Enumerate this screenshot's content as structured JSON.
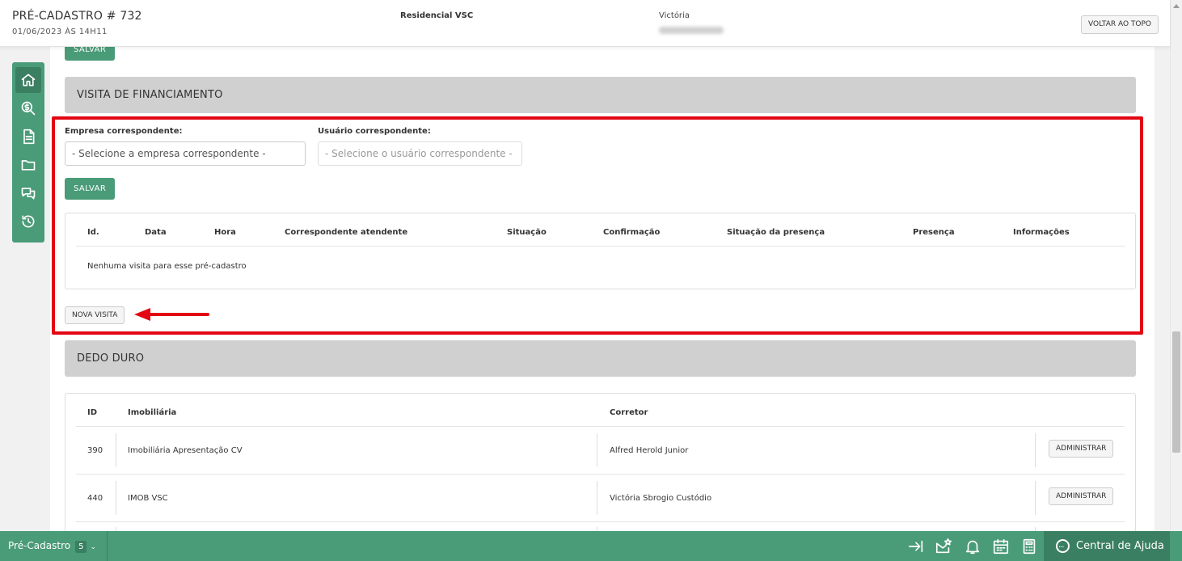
{
  "header": {
    "title": "PRÉ-CADASTRO # 732",
    "datetime": "01/06/2023 ÀS 14H11",
    "empreendimento": "Residencial VSC",
    "cliente": "Victória",
    "voltar_topo": "VOLTAR AO TOPO"
  },
  "sidebar": {
    "items": [
      {
        "icon": "home-icon"
      },
      {
        "icon": "dollar-search-icon"
      },
      {
        "icon": "document-icon"
      },
      {
        "icon": "folder-icon"
      },
      {
        "icon": "chat-icon"
      },
      {
        "icon": "history-icon"
      }
    ]
  },
  "top_save": "SALVAR",
  "visita": {
    "section_title": "VISITA DE FINANCIAMENTO",
    "empresa_label": "Empresa correspondente:",
    "empresa_placeholder": "- Selecione a empresa correspondente -",
    "usuario_label": "Usuário correspondente:",
    "usuario_placeholder": "- Selecione o usuário correspondente -",
    "save": "SALVAR",
    "columns": [
      "Id.",
      "Data",
      "Hora",
      "Correspondente atendente",
      "Situação",
      "Confirmação",
      "Situação da presença",
      "Presença",
      "Informações"
    ],
    "empty": "Nenhuma visita para esse pré-cadastro",
    "nova_visita": "NOVA VISITA"
  },
  "dedo_duro": {
    "section_title": "DEDO DURO",
    "columns": [
      "ID",
      "Imobiliária",
      "Corretor"
    ],
    "rows": [
      {
        "id": "390",
        "imobiliaria": "Imobiliária Apresentação CV",
        "corretor": "Alfred Herold Junior",
        "action": "ADMINISTRAR"
      },
      {
        "id": "440",
        "imobiliaria": "IMOB VSC",
        "corretor": "Victória Sbrogio Custódio",
        "action": "ADMINISTRAR"
      }
    ]
  },
  "bottombar": {
    "tab_label": "Pré-Cadastro",
    "tab_count": "5",
    "icons": [
      "collapse-right-icon",
      "mail-star-icon",
      "bell-icon",
      "calendar-icon",
      "calculator-icon"
    ],
    "help": "Central de Ajuda"
  },
  "colors": {
    "accent": "#4a9b78",
    "accent_dark": "#3b7f62",
    "highlight": "#e30613",
    "section_header": "#d0d0d0"
  }
}
